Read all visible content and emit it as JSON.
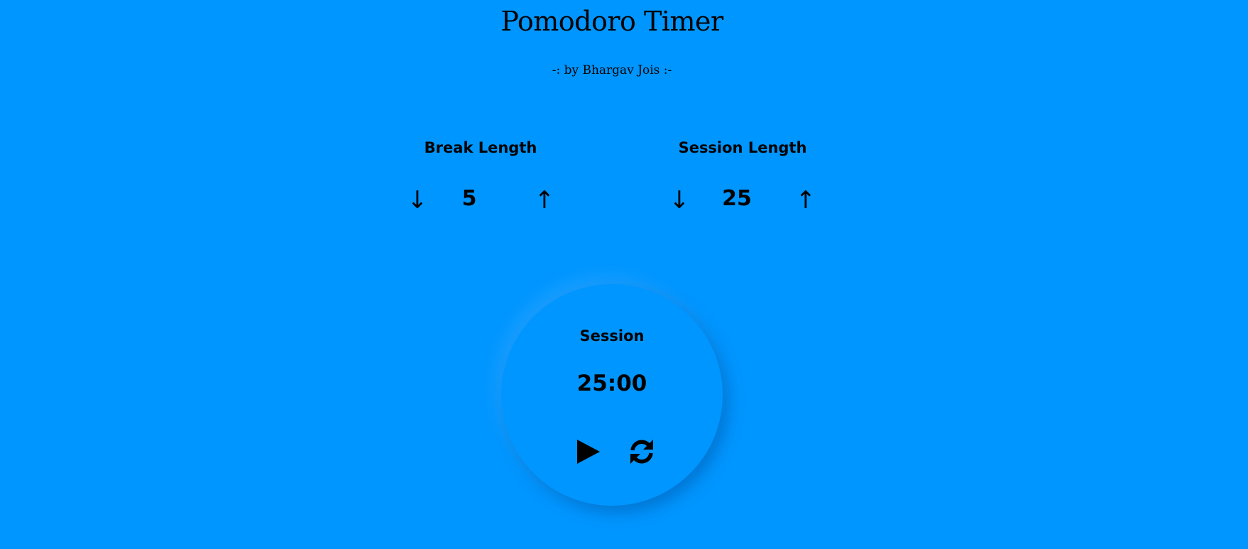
{
  "header": {
    "title": "Pomodoro Timer",
    "subtitle": "-: by Bhargav Jois :-"
  },
  "break": {
    "label": "Break Length",
    "value": "5",
    "decrement_icon": "↓",
    "increment_icon": "↑"
  },
  "session": {
    "label": "Session Length",
    "value": "25",
    "decrement_icon": "↓",
    "increment_icon": "↑"
  },
  "timer": {
    "label": "Session",
    "time_left": "25:00",
    "play_icon": "play-icon",
    "reset_icon": "refresh-icon"
  },
  "colors": {
    "background": "#0096ff",
    "foreground": "#000000"
  }
}
